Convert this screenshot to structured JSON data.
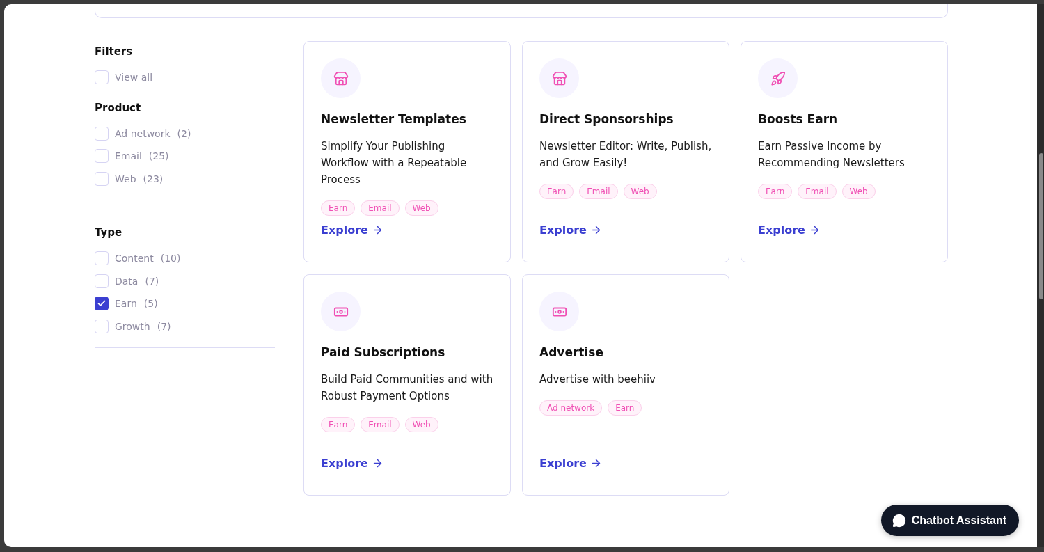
{
  "filters": {
    "title": "Filters",
    "view_all": {
      "label": "View all",
      "checked": false
    },
    "groups": [
      {
        "title": "Product",
        "options": [
          {
            "label": "Ad network",
            "count": "(2)",
            "checked": false
          },
          {
            "label": "Email",
            "count": "(25)",
            "checked": false
          },
          {
            "label": "Web",
            "count": "(23)",
            "checked": false
          }
        ]
      },
      {
        "title": "Type",
        "options": [
          {
            "label": "Content",
            "count": "(10)",
            "checked": false
          },
          {
            "label": "Data",
            "count": "(7)",
            "checked": false
          },
          {
            "label": "Earn",
            "count": "(5)",
            "checked": true
          },
          {
            "label": "Growth",
            "count": "(7)",
            "checked": false
          }
        ]
      }
    ]
  },
  "cards": [
    {
      "kind": "store",
      "title": "Newsletter Templates",
      "description": "Simplify Your Publishing Workflow with a Repeatable Process",
      "tags": [
        "Earn",
        "Email",
        "Web"
      ],
      "link": "Explore"
    },
    {
      "kind": "store",
      "title": "Direct Sponsorships",
      "description": "Newsletter Editor: Write, Publish, and Grow Easily!",
      "tags": [
        "Earn",
        "Email",
        "Web"
      ],
      "link": "Explore"
    },
    {
      "kind": "rocket",
      "title": "Boosts Earn",
      "description": "Earn Passive Income by Recommending Newsletters",
      "tags": [
        "Earn",
        "Email",
        "Web"
      ],
      "link": "Explore"
    },
    {
      "kind": "money",
      "title": "Paid Subscriptions",
      "description": "Build Paid Communities and with Robust Payment Options",
      "tags": [
        "Earn",
        "Email",
        "Web"
      ],
      "link": "Explore"
    },
    {
      "kind": "money",
      "title": "Advertise",
      "description": "Advertise with beehiiv",
      "tags": [
        "Ad network",
        "Earn"
      ],
      "link": "Explore"
    }
  ],
  "chatbot": {
    "label": "Chatbot Assistant"
  }
}
